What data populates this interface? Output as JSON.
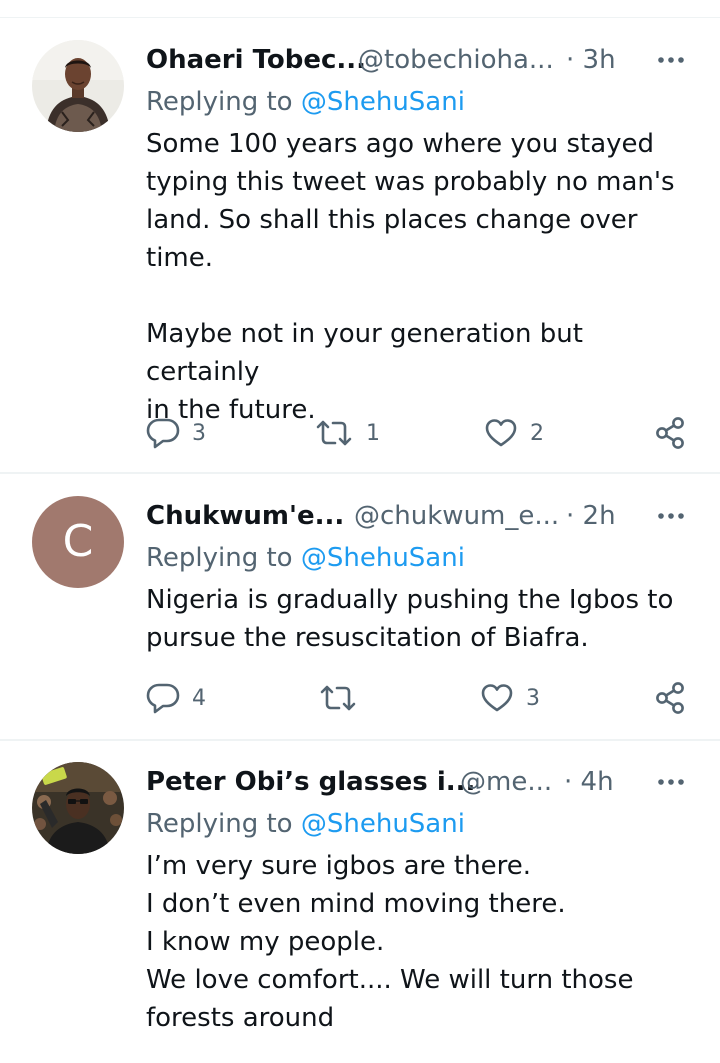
{
  "tweets": [
    {
      "name": "Ohaeri Tobec...",
      "handle": "@tobechioha...",
      "time": "· 3h",
      "replying_prefix": "Replying to ",
      "replying_to": "@ShehuSani",
      "text": "Some 100 years ago where you stayed\ntyping this tweet was probably no man's\nland. So shall this places change over\ntime.\n\nMaybe not in your generation but certainly\nin the future.",
      "replies": "3",
      "retweets": "1",
      "likes": "2",
      "avatar_icon": "profile-photo"
    },
    {
      "name": "Chukwum'e...",
      "handle": "@chukwum_e...",
      "time": "· 2h",
      "replying_prefix": "Replying to ",
      "replying_to": "@ShehuSani",
      "text": "Nigeria is gradually pushing the Igbos to\npursue the resuscitation of Biafra.",
      "replies": "4",
      "retweets": "",
      "likes": "3",
      "avatar_letter": "C",
      "avatar_color": "#a1796e"
    },
    {
      "name": "Peter Obi’s glasses i...",
      "handle": "@me...",
      "time": "· 4h",
      "replying_prefix": "Replying to ",
      "replying_to": "@ShehuSani",
      "text": "I’m very sure igbos are there.\nI don’t even mind moving there.\nI know my people.\nWe love comfort.... We will turn those\nforests around",
      "avatar_icon": "profile-photo"
    }
  ],
  "colors": {
    "primary_text": "#0f1419",
    "secondary_text": "#536471",
    "link": "#1d9bf0",
    "divider": "#eff3f4"
  }
}
